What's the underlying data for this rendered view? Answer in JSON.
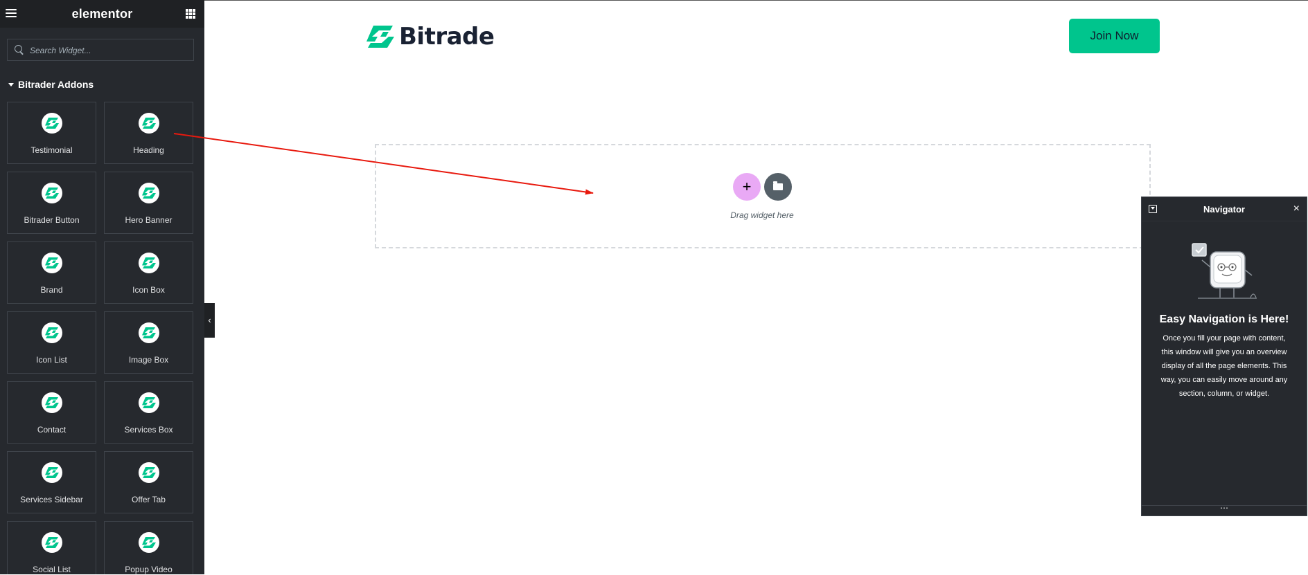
{
  "sidebar": {
    "logo": "elementor",
    "search_placeholder": "Search Widget...",
    "category": "Bitrader Addons",
    "widgets": [
      {
        "label": "Testimonial"
      },
      {
        "label": "Heading"
      },
      {
        "label": "Bitrader Button"
      },
      {
        "label": "Hero Banner"
      },
      {
        "label": "Brand"
      },
      {
        "label": "Icon Box"
      },
      {
        "label": "Icon List"
      },
      {
        "label": "Image Box"
      },
      {
        "label": "Contact"
      },
      {
        "label": "Services Box"
      },
      {
        "label": "Services Sidebar"
      },
      {
        "label": "Offer Tab"
      },
      {
        "label": "Social List"
      },
      {
        "label": "Popup Video"
      }
    ],
    "collapse_icon": "‹"
  },
  "canvas": {
    "brand": "Bitrade",
    "join_label": "Join Now",
    "dropzone_text": "Drag widget here",
    "add_icon": "+"
  },
  "navigator": {
    "title": "Navigator",
    "close_icon": "×",
    "heading": "Easy Navigation is Here!",
    "body": "Once you fill your page with content, this window will give you an overview display of all the page elements. This way, you can easily move around any section, column, or widget.",
    "footer_icon": "⋯"
  },
  "colors": {
    "brand_green": "#00c58d",
    "panel_dark": "#26292e",
    "arrow_red": "#e8190e",
    "add_button_pink": "#e9a9f5"
  }
}
